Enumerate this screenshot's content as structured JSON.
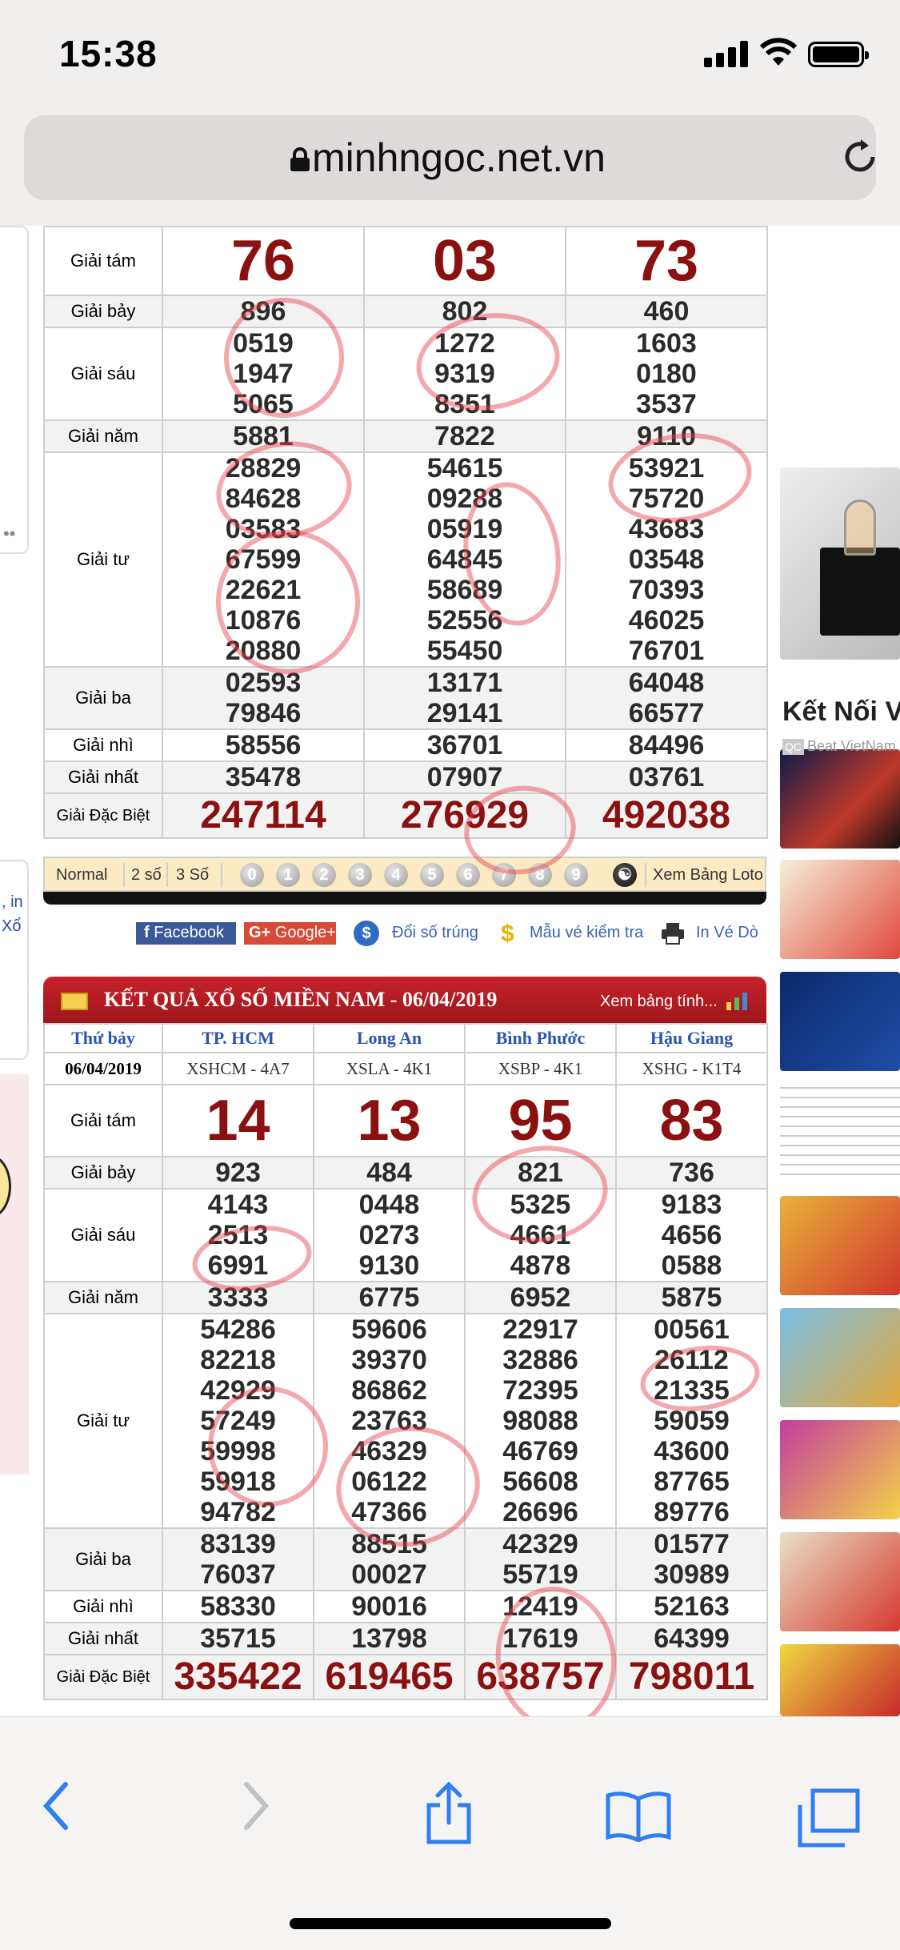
{
  "status": {
    "time": "15:38"
  },
  "browser": {
    "url": "minhngoc.net.vn"
  },
  "left_strip": {
    "text1": ", in",
    "text2": "Xổ"
  },
  "table1": {
    "rows": [
      {
        "label": "Giải tám",
        "type": "big",
        "values": [
          "76",
          "03",
          "73"
        ]
      },
      {
        "label": "Giải bảy",
        "type": "alt",
        "values": [
          "896",
          "802",
          "460"
        ]
      },
      {
        "label": "Giải sáu",
        "type": "normal",
        "values": [
          "0519\n1947\n5065",
          "1272\n9319\n8351",
          "1603\n0180\n3537"
        ]
      },
      {
        "label": "Giải năm",
        "type": "alt",
        "values": [
          "5881",
          "7822",
          "9110"
        ]
      },
      {
        "label": "Giải tư",
        "type": "normal",
        "values": [
          "28829\n84628\n03583\n67599\n22621\n10876\n20880",
          "54615\n09288\n05919\n64845\n58689\n52556\n55450",
          "53921\n75720\n43683\n03548\n70393\n46025\n76701"
        ]
      },
      {
        "label": "Giải ba",
        "type": "alt",
        "values": [
          "02593\n79846",
          "13171\n29141",
          "64048\n66577"
        ]
      },
      {
        "label": "Giải nhì",
        "type": "normal",
        "values": [
          "58556",
          "36701",
          "84496"
        ]
      },
      {
        "label": "Giải nhất",
        "type": "alt",
        "values": [
          "35478",
          "07907",
          "03761"
        ]
      },
      {
        "label": "Giải Đặc Biệt",
        "type": "db",
        "values": [
          "247114",
          "276929",
          "492038"
        ]
      }
    ]
  },
  "nav": {
    "normal": "Normal",
    "two": "2 số",
    "three": "3 Số",
    "digits": [
      "0",
      "1",
      "2",
      "3",
      "4",
      "5",
      "6",
      "7",
      "8",
      "9"
    ],
    "loto": "Xem Bảng Loto"
  },
  "social": {
    "facebook": "Facebook",
    "google": "Google+",
    "doiso": "Đổi số trúng",
    "mauve": "Mẫu vé kiểm tra",
    "invedo": "In Vé Dò"
  },
  "section2": {
    "title": "KẾT QUẢ XỔ SỐ MIỀN NAM - 06/04/2019",
    "link": "Xem bảng tính..."
  },
  "table2": {
    "head": [
      "Thứ bảy",
      "TP. HCM",
      "Long An",
      "Bình Phước",
      "Hậu Giang"
    ],
    "date": "06/04/2019",
    "codes": [
      "XSHCM - 4A7",
      "XSLA - 4K1",
      "XSBP - 4K1",
      "XSHG - K1T4"
    ],
    "rows": [
      {
        "label": "Giải tám",
        "type": "big",
        "values": [
          "14",
          "13",
          "95",
          "83"
        ]
      },
      {
        "label": "Giải bảy",
        "type": "alt",
        "values": [
          "923",
          "484",
          "821",
          "736"
        ]
      },
      {
        "label": "Giải sáu",
        "type": "normal",
        "values": [
          "4143\n2513\n6991",
          "0448\n0273\n9130",
          "5325\n4661\n4878",
          "9183\n4656\n0588"
        ]
      },
      {
        "label": "Giải năm",
        "type": "alt",
        "values": [
          "3333",
          "6775",
          "6952",
          "5875"
        ]
      },
      {
        "label": "Giải tư",
        "type": "normal",
        "values": [
          "54286\n82218\n42929\n57249\n59998\n59918\n94782",
          "59606\n39370\n86862\n23763\n46329\n06122\n47366",
          "22917\n32886\n72395\n98088\n46769\n56608\n26696",
          "00561\n26112\n21335\n59059\n43600\n87765\n89776"
        ]
      },
      {
        "label": "Giải ba",
        "type": "alt",
        "values": [
          "83139\n76037",
          "88515\n00027",
          "42329\n55719",
          "01577\n30989"
        ]
      },
      {
        "label": "Giải nhì",
        "type": "normal",
        "values": [
          "58330",
          "90016",
          "12419",
          "52163"
        ]
      },
      {
        "label": "Giải nhất",
        "type": "alt",
        "values": [
          "35715",
          "13798",
          "17619",
          "64399"
        ]
      },
      {
        "label": "Giải Đặc Biệt",
        "type": "db",
        "values": [
          "335422",
          "619465",
          "638757",
          "798011"
        ]
      }
    ]
  },
  "ads": {
    "title": "Kết Nối V",
    "qc": "QC",
    "sub": "Beat VietNam"
  }
}
